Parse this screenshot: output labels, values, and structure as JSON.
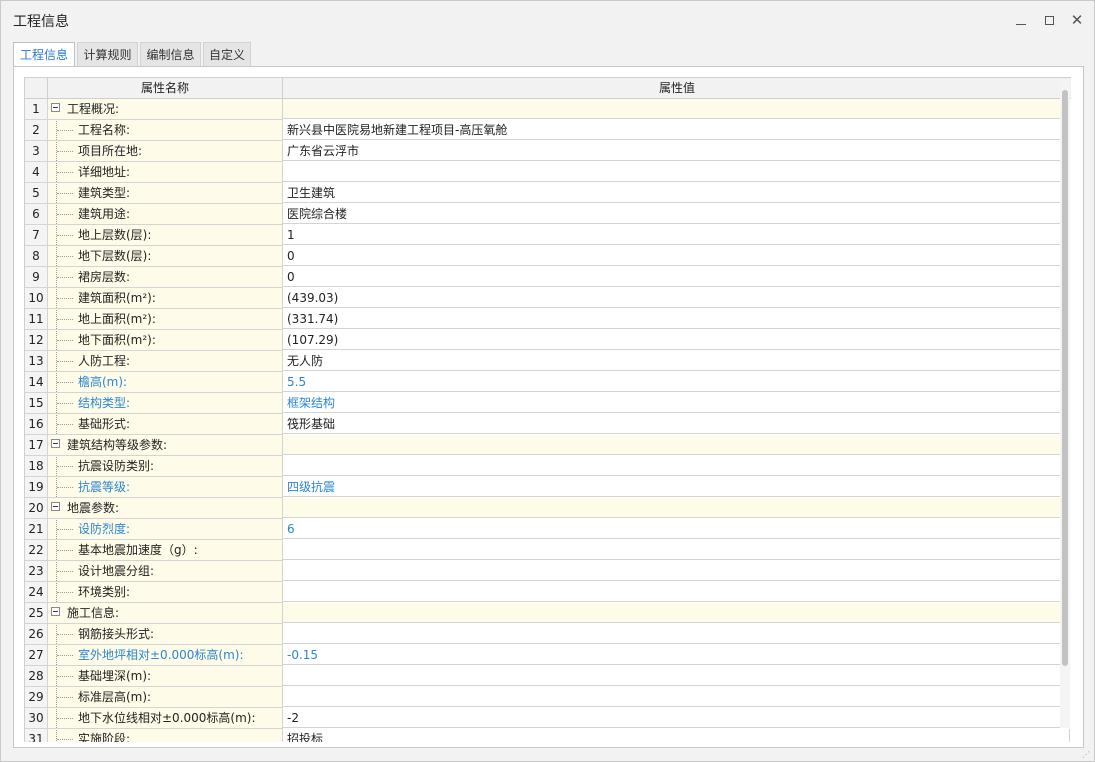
{
  "window": {
    "title": "工程信息"
  },
  "tabs": [
    {
      "label": "工程信息",
      "active": true
    },
    {
      "label": "计算规则",
      "active": false
    },
    {
      "label": "编制信息",
      "active": false
    },
    {
      "label": "自定义",
      "active": false
    }
  ],
  "grid": {
    "columns": [
      "属性名称",
      "属性值"
    ],
    "rows": [
      {
        "n": "1",
        "name": "工程概况:",
        "value": "",
        "group": true,
        "highlight": false
      },
      {
        "n": "2",
        "name": "工程名称:",
        "value": "新兴县中医院易地新建工程项目-高压氧舱",
        "group": false,
        "highlight": false
      },
      {
        "n": "3",
        "name": "项目所在地:",
        "value": "广东省云浮市",
        "group": false,
        "highlight": false
      },
      {
        "n": "4",
        "name": "详细地址:",
        "value": "",
        "group": false,
        "highlight": false
      },
      {
        "n": "5",
        "name": "建筑类型:",
        "value": "卫生建筑",
        "group": false,
        "highlight": false
      },
      {
        "n": "6",
        "name": "建筑用途:",
        "value": "医院综合楼",
        "group": false,
        "highlight": false
      },
      {
        "n": "7",
        "name": "地上层数(层):",
        "value": "1",
        "group": false,
        "highlight": false
      },
      {
        "n": "8",
        "name": "地下层数(层):",
        "value": "0",
        "group": false,
        "highlight": false
      },
      {
        "n": "9",
        "name": "裙房层数:",
        "value": "0",
        "group": false,
        "highlight": false
      },
      {
        "n": "10",
        "name": "建筑面积(m²):",
        "value": "(439.03)",
        "group": false,
        "highlight": false
      },
      {
        "n": "11",
        "name": "地上面积(m²):",
        "value": "(331.74)",
        "group": false,
        "highlight": false
      },
      {
        "n": "12",
        "name": "地下面积(m²):",
        "value": "(107.29)",
        "group": false,
        "highlight": false
      },
      {
        "n": "13",
        "name": "人防工程:",
        "value": "无人防",
        "group": false,
        "highlight": false
      },
      {
        "n": "14",
        "name": "檐高(m):",
        "value": "5.5",
        "group": false,
        "highlight": true
      },
      {
        "n": "15",
        "name": "结构类型:",
        "value": "框架结构",
        "group": false,
        "highlight": true
      },
      {
        "n": "16",
        "name": "基础形式:",
        "value": "筏形基础",
        "group": false,
        "highlight": false
      },
      {
        "n": "17",
        "name": "建筑结构等级参数:",
        "value": "",
        "group": true,
        "highlight": false
      },
      {
        "n": "18",
        "name": "抗震设防类别:",
        "value": "",
        "group": false,
        "highlight": false
      },
      {
        "n": "19",
        "name": "抗震等级:",
        "value": "四级抗震",
        "group": false,
        "highlight": true
      },
      {
        "n": "20",
        "name": "地震参数:",
        "value": "",
        "group": true,
        "highlight": false
      },
      {
        "n": "21",
        "name": "设防烈度:",
        "value": "6",
        "group": false,
        "highlight": true
      },
      {
        "n": "22",
        "name": "基本地震加速度（g）:",
        "value": "",
        "group": false,
        "highlight": false
      },
      {
        "n": "23",
        "name": "设计地震分组:",
        "value": "",
        "group": false,
        "highlight": false
      },
      {
        "n": "24",
        "name": "环境类别:",
        "value": "",
        "group": false,
        "highlight": false
      },
      {
        "n": "25",
        "name": "施工信息:",
        "value": "",
        "group": true,
        "highlight": false
      },
      {
        "n": "26",
        "name": "钢筋接头形式:",
        "value": "",
        "group": false,
        "highlight": false
      },
      {
        "n": "27",
        "name": "室外地坪相对±0.000标高(m):",
        "value": "-0.15",
        "group": false,
        "highlight": true
      },
      {
        "n": "28",
        "name": "基础埋深(m):",
        "value": "",
        "group": false,
        "highlight": false
      },
      {
        "n": "29",
        "name": "标准层高(m):",
        "value": "",
        "group": false,
        "highlight": false
      },
      {
        "n": "30",
        "name": "地下水位线相对±0.000标高(m):",
        "value": "-2",
        "group": false,
        "highlight": false
      },
      {
        "n": "31",
        "name": "实施阶段:",
        "value": "招投标",
        "group": false,
        "highlight": false
      }
    ]
  },
  "colors": {
    "accent": "#2878c8",
    "name_cell_bg": "#fefce8"
  }
}
